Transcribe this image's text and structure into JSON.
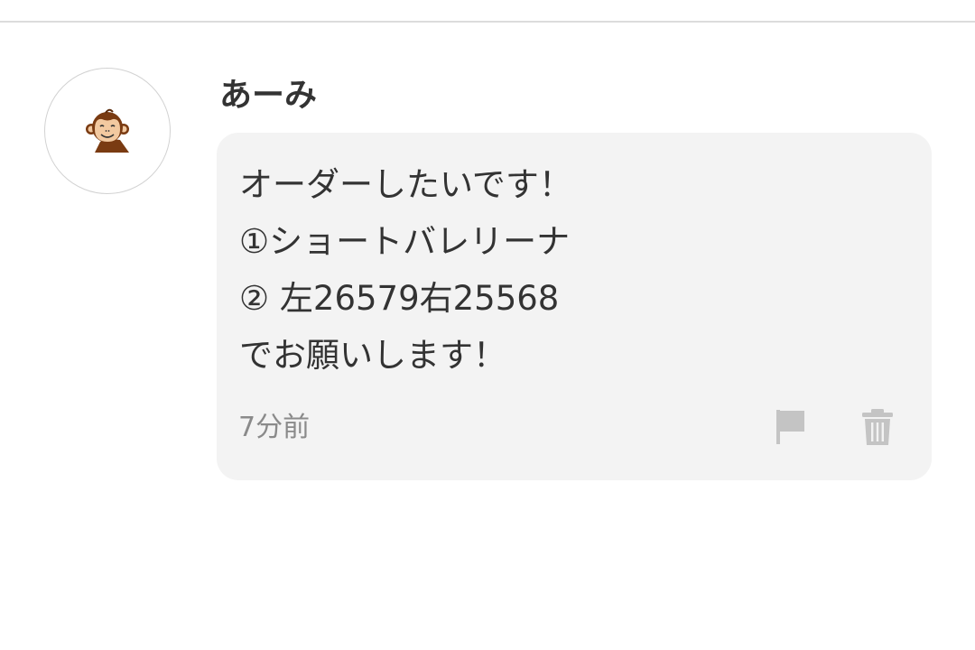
{
  "post": {
    "username": "あーみ",
    "avatar_icon": "monkey-avatar-icon",
    "message_lines": [
      "オーダーしたいです！",
      "①ショートバレリーナ",
      "②  左26579右25568",
      "でお願いします！"
    ],
    "timestamp": "7分前",
    "actions": [
      {
        "icon": "flag-icon"
      },
      {
        "icon": "trash-icon"
      }
    ]
  },
  "colors": {
    "bubble_background": "#f3f3f3",
    "text": "#333333",
    "muted_text": "#8a8a8a",
    "icon_gray": "#c4c4c4",
    "divider": "#dcdcdc"
  }
}
